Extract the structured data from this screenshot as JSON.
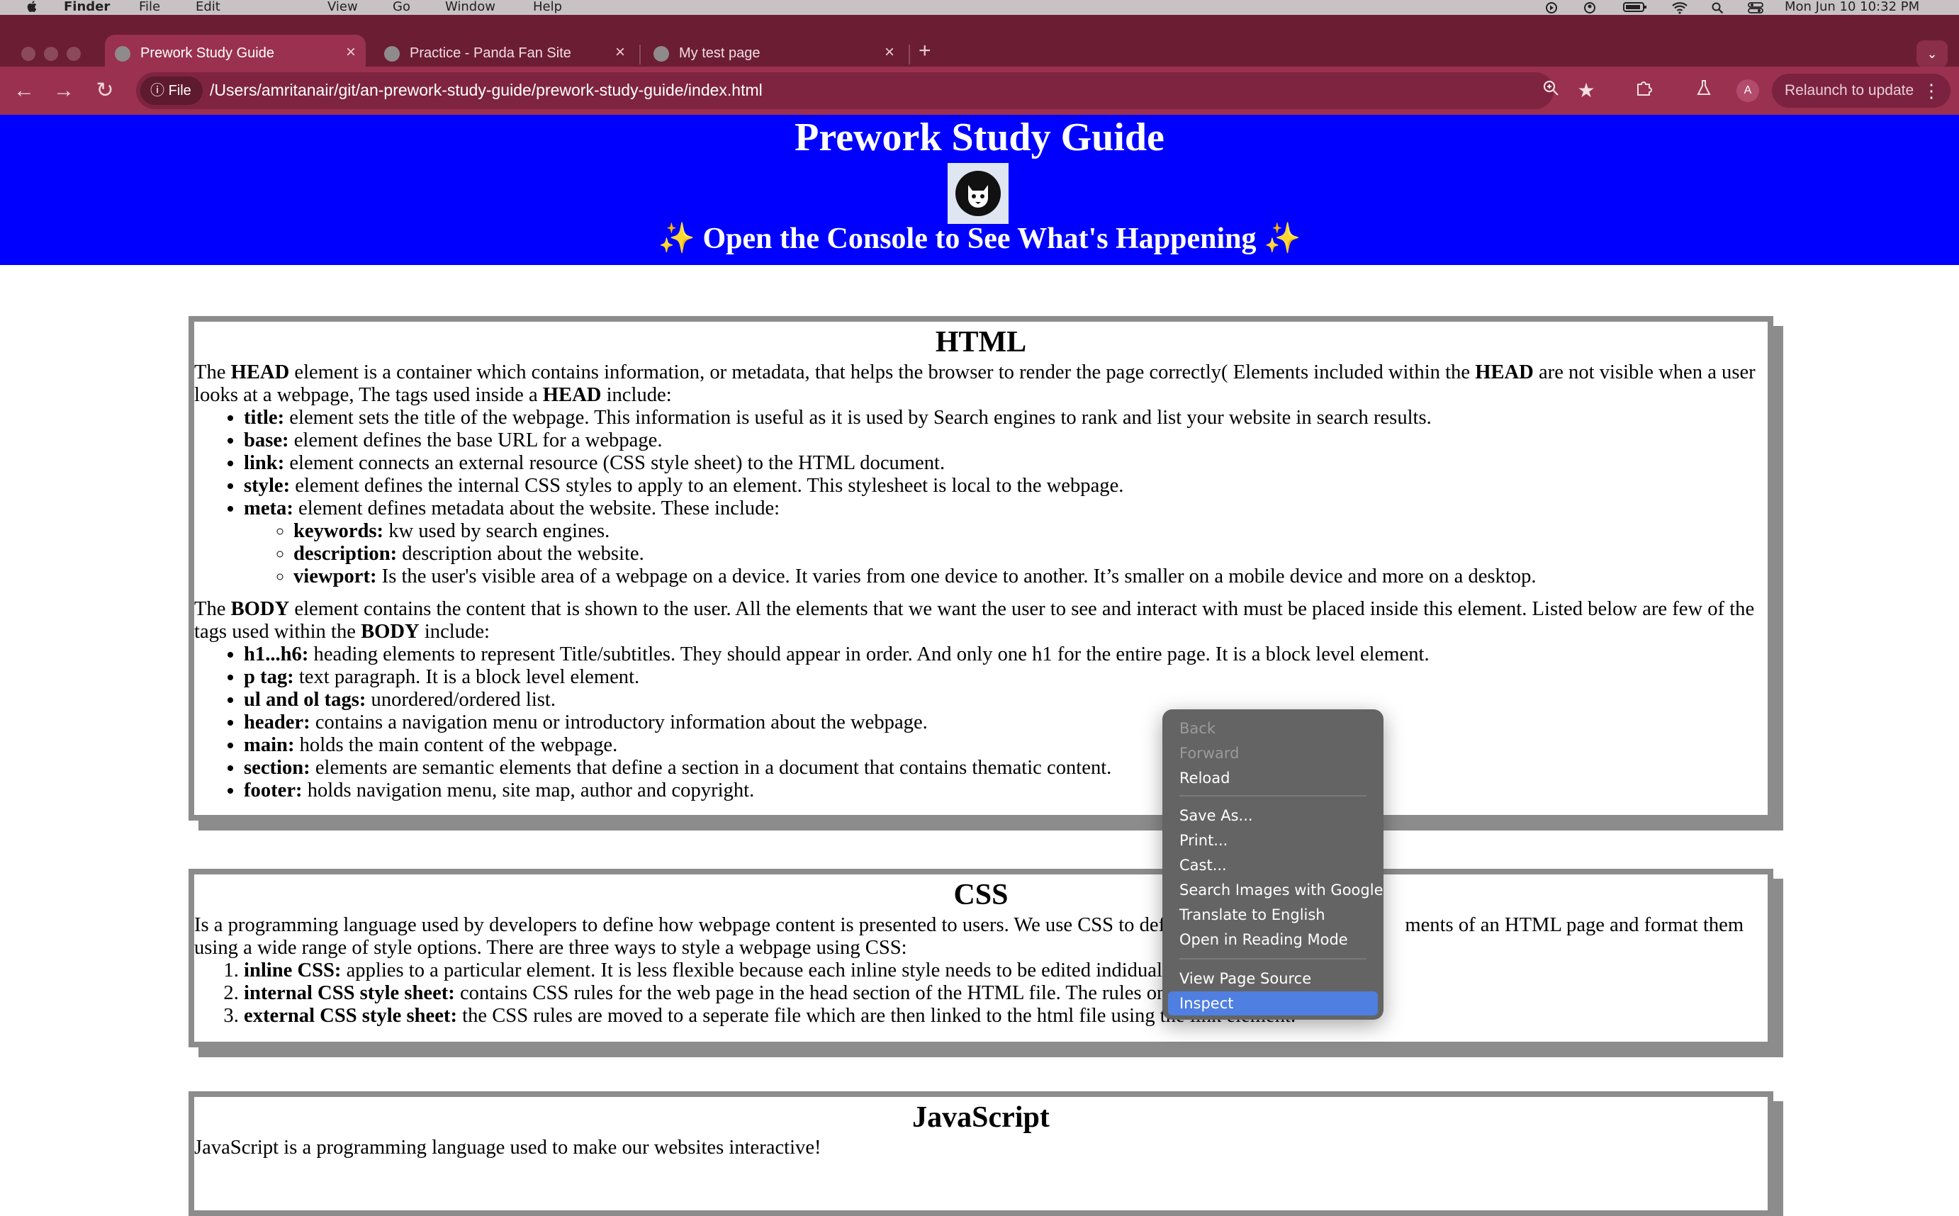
{
  "menubar": {
    "apple": "",
    "items": [
      "Finder",
      "File",
      "Edit",
      "View",
      "Go",
      "Window",
      "Help"
    ],
    "clock": "Mon Jun 10  10:32 PM"
  },
  "browser": {
    "tabs": [
      {
        "title": "Prework Study Guide",
        "active": true
      },
      {
        "title": "Practice - Panda Fan Site",
        "active": false
      },
      {
        "title": "My test page",
        "active": false
      }
    ],
    "new_tab": "+",
    "omnibox": {
      "chip": "File",
      "url": "/Users/amritanair/git/an-prework-study-guide/prework-study-guide/index.html"
    },
    "avatar": "A",
    "relaunch": "Relaunch to update"
  },
  "page": {
    "title": "Prework Study Guide",
    "subtitle": "✨ Open the Console to See What's Happening ✨",
    "html_section": {
      "heading": "HTML",
      "head_p": {
        "t1": "The ",
        "b1": "HEAD",
        "t2": " element is a container which contains information, or metadata, that helps the browser to render the page correctly( Elements included within the ",
        "b2": "HEAD",
        "t3": " are not visible when a user looks at a webpage, The tags used inside a ",
        "b3": "HEAD",
        "t4": " include:"
      },
      "head_items": [
        {
          "term": "title:",
          "desc": " element sets the title of the webpage. This information is useful as it is used by Search engines to rank and list your website in search results."
        },
        {
          "term": "base:",
          "desc": " element defines the base URL for a webpage."
        },
        {
          "term": "link:",
          "desc": " element connects an external resource (CSS style sheet) to the HTML document."
        },
        {
          "term": "style:",
          "desc": " element defines the internal CSS styles to apply to an element. This stylesheet is local to the webpage."
        },
        {
          "term": "meta:",
          "desc": " element defines metadata about the website. These include:"
        }
      ],
      "meta_items": [
        {
          "term": "keywords:",
          "desc": " kw used by search engines."
        },
        {
          "term": "description:",
          "desc": " description about the website."
        },
        {
          "term": "viewport:",
          "desc": " Is the user's visible area of a webpage on a device. It varies from one device to another. It’s smaller on a mobile device and more on a desktop."
        }
      ],
      "body_p": {
        "t1": "The ",
        "b1": "BODY",
        "t2": " element contains the content that is shown to the user. All the elements that we want the user to see and interact with must be placed inside this element. Listed below are few of the tags used within the ",
        "b2": "BODY",
        "t3": " include:"
      },
      "body_items": [
        {
          "term": "h1...h6:",
          "desc": " heading elements to represent Title/subtitles. They should appear in order. And only one h1 for the entire page. It is a block level element."
        },
        {
          "term": "p tag:",
          "desc": " text paragraph. It is a block level element."
        },
        {
          "term": "ul and ol tags:",
          "desc": " unordered/ordered list."
        },
        {
          "term": "header:",
          "desc": " contains a navigation menu or introductory information about the webpage."
        },
        {
          "term": "main:",
          "desc": " holds the main content of the webpage."
        },
        {
          "term": "section:",
          "desc": " elements are semantic elements that define a section in a document that contains thematic content."
        },
        {
          "term": "footer:",
          "desc": " holds navigation menu, site map, author and copyright."
        }
      ]
    },
    "css_section": {
      "heading": "CSS",
      "intro_a": "Is a programming language used by developers to define how webpage content is presented to users. We use CSS to defin",
      "intro_b": "ments of an HTML page and format them using a wide range of style options. There are three ways to style a webpage using CSS:",
      "items": [
        {
          "term": "inline CSS:",
          "desc": " applies to a particular element. It is less flexible because each inline style needs to be edited indidually"
        },
        {
          "term": "internal CSS style sheet:",
          "desc": " contains CSS rules for the web page in the head section of the HTML file. The rules only"
        },
        {
          "term": "external CSS style sheet:",
          "desc": " the CSS rules are moved to a seperate file which are then linked to the html file using the link element."
        }
      ]
    },
    "js_section": {
      "heading": "JavaScript",
      "intro": "JavaScript is a programming language used to make our websites interactive!"
    }
  },
  "context_menu": {
    "items": [
      {
        "label": "Back",
        "disabled": true
      },
      {
        "label": "Forward",
        "disabled": true
      },
      {
        "label": "Reload",
        "disabled": false
      },
      {
        "label": "Save As...",
        "disabled": false
      },
      {
        "label": "Print...",
        "disabled": false
      },
      {
        "label": "Cast...",
        "disabled": false
      },
      {
        "label": "Search Images with Google",
        "disabled": false
      },
      {
        "label": "Translate to English",
        "disabled": false
      },
      {
        "label": "Open in Reading Mode",
        "disabled": false
      },
      {
        "label": "View Page Source",
        "disabled": false
      },
      {
        "label": "Inspect",
        "disabled": false,
        "highlighted": true
      }
    ]
  },
  "colors": {
    "banner": "#0000ff",
    "tabstrip": "#6b1d34",
    "toolbar": "#9a3151",
    "menu_highlight": "#4f7fe0"
  }
}
